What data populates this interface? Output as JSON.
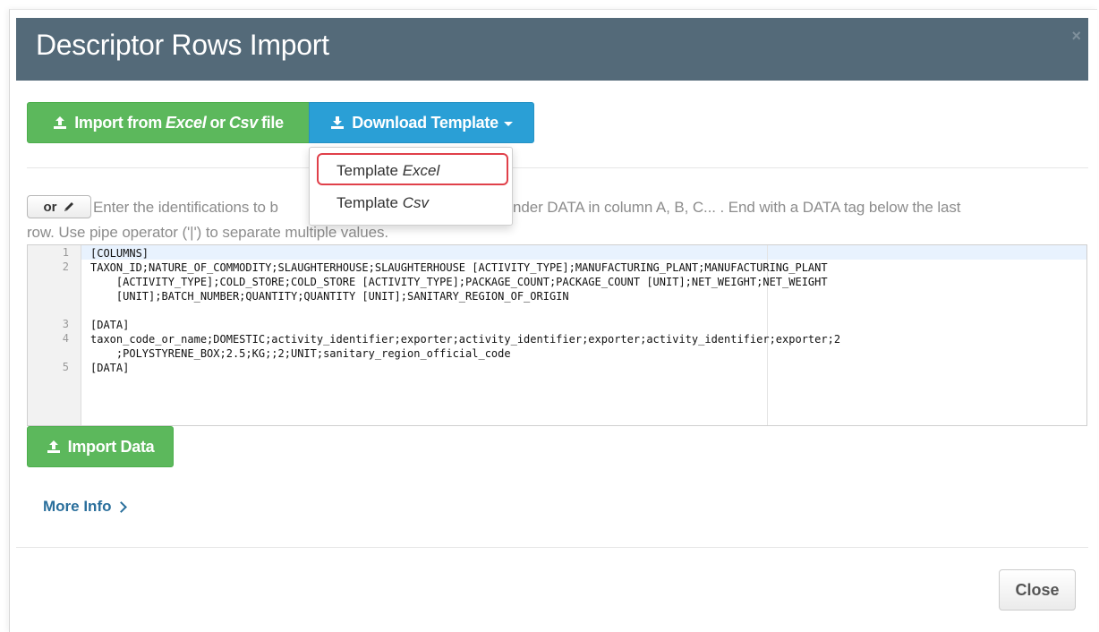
{
  "modal": {
    "title": "Descriptor Rows Import",
    "close_glyph": "×"
  },
  "toolbar": {
    "import_file": {
      "prefix": "Import from",
      "excel": "Excel",
      "or": "or",
      "csv": "Csv",
      "suffix": "file",
      "icon": "upload-icon"
    },
    "download": {
      "label": "Download Template",
      "icon": "download-icon"
    }
  },
  "dropdown": {
    "items": [
      {
        "prefix": "Template",
        "format": "Excel"
      },
      {
        "prefix": "Template",
        "format": "Csv"
      }
    ]
  },
  "instructions": {
    "or_label": "or",
    "pencil_icon": "pencil-icon",
    "line1_start": "Enter the identifications to b",
    "line1_end": "nder DATA in column A, B, C... . End with a DATA tag below the last",
    "line2": "row. Use pipe operator ('|') to separate multiple values."
  },
  "editor": {
    "line_numbers": [
      "1",
      "2",
      "3",
      "4",
      "5"
    ],
    "lines": [
      "[COLUMNS]",
      "TAXON_ID;NATURE_OF_COMMODITY;SLAUGHTERHOUSE;SLAUGHTERHOUSE [ACTIVITY_TYPE];MANUFACTURING_PLANT;MANUFACTURING_PLANT\n    [ACTIVITY_TYPE];COLD_STORE;COLD_STORE [ACTIVITY_TYPE];PACKAGE_COUNT;PACKAGE_COUNT [UNIT];NET_WEIGHT;NET_WEIGHT\n    [UNIT];BATCH_NUMBER;QUANTITY;QUANTITY [UNIT];SANITARY_REGION_OF_ORIGIN",
      "[DATA]",
      "taxon_code_or_name;DOMESTIC;activity_identifier;exporter;activity_identifier;exporter;activity_identifier;exporter;2\n    ;POLYSTYRENE_BOX;2.5;KG;;2;UNIT;sanitary_region_official_code",
      "[DATA]"
    ]
  },
  "import_data": {
    "label": "Import Data",
    "icon": "upload-icon"
  },
  "more_info": {
    "label": "More Info",
    "icon": "chevron-right-icon"
  },
  "footer": {
    "close_label": "Close"
  }
}
